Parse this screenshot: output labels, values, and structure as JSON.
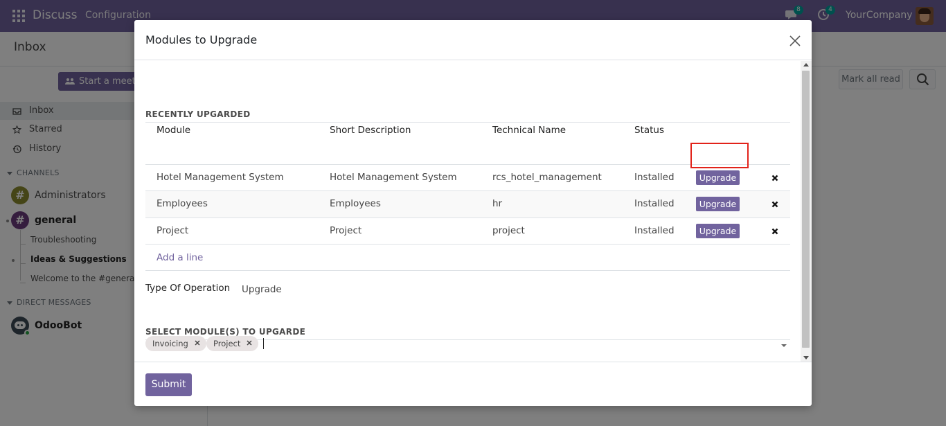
{
  "navbar": {
    "app_name": "Discuss",
    "menu_configuration": "Configuration",
    "chat_badge": "8",
    "activity_badge": "4",
    "company": "YourCompany"
  },
  "control_panel": {
    "breadcrumb": "Inbox",
    "mark_all_read": "Mark all read"
  },
  "sidebar": {
    "start_meeting": "Start a meeting",
    "mailboxes": [
      {
        "label": "Inbox"
      },
      {
        "label": "Starred"
      },
      {
        "label": "History"
      }
    ],
    "channels_header": "CHANNELS",
    "channels": [
      {
        "label": "Administrators",
        "avatar_color": "#8a8a2e"
      },
      {
        "label": "general",
        "avatar_color": "#6b3a7d"
      }
    ],
    "sub_channels": [
      {
        "label": "Troubleshooting"
      },
      {
        "label": "Ideas & Suggestions"
      },
      {
        "label": "Welcome to the #general channel"
      }
    ],
    "dm_header": "DIRECT MESSAGES",
    "dms": [
      {
        "label": "OdooBot"
      }
    ]
  },
  "modal": {
    "title": "Modules to Upgrade",
    "recently_upgraded_title": "RECENTLY UPGARDED",
    "columns": [
      "Module",
      "Short Description",
      "Technical Name",
      "Status"
    ],
    "rows": [
      {
        "module": "Hotel Management System",
        "description": "Hotel Management System",
        "technical_name": "rcs_hotel_management",
        "status": "Installed",
        "action": "Upgrade"
      },
      {
        "module": "Employees",
        "description": "Employees",
        "technical_name": "hr",
        "status": "Installed",
        "action": "Upgrade"
      },
      {
        "module": "Project",
        "description": "Project",
        "technical_name": "project",
        "status": "Installed",
        "action": "Upgrade"
      }
    ],
    "add_line": "Add a line",
    "type_of_operation_label": "Type Of Operation",
    "type_of_operation_value": "Upgrade",
    "select_modules_title": "SELECT MODULE(S) TO UPGARDE",
    "selected_tags": [
      {
        "label": "Invoicing"
      },
      {
        "label": "Project"
      }
    ],
    "submit": "Submit"
  },
  "colors": {
    "brand": "#71639e",
    "highlight": "#e2231a",
    "badge": "#00a09d"
  }
}
